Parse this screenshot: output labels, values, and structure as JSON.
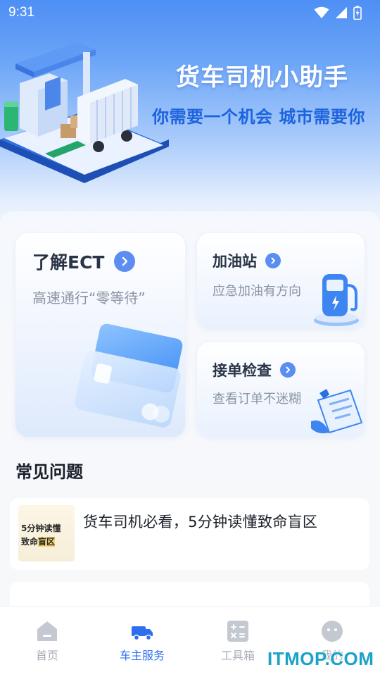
{
  "status_bar": {
    "time": "9:31"
  },
  "hero": {
    "title": "货车司机小助手",
    "subtitle": "你需要一个机会 城市需要你"
  },
  "cards": {
    "ect": {
      "title": "了解ECT",
      "desc": "高速通行“零等待”"
    },
    "gas": {
      "title": "加油站",
      "desc": "应急加油有方向"
    },
    "order": {
      "title": "接单检查",
      "desc": "查看订单不迷糊"
    }
  },
  "faq": {
    "section_title": "常见问题",
    "articles": [
      {
        "title": "货车司机必看，5分钟读懂致命盲区",
        "thumb_line1": "5分钟读懂",
        "thumb_line2_a": "致命",
        "thumb_line2_b": "盲区"
      }
    ]
  },
  "tabbar": {
    "tabs": [
      {
        "label": "首页",
        "icon": "home-icon"
      },
      {
        "label": "车主服务",
        "icon": "truck-icon"
      },
      {
        "label": "工具箱",
        "icon": "calculator-icon"
      },
      {
        "label": "我的",
        "icon": "profile-icon"
      }
    ],
    "active_index": 1,
    "active_color": "#2e6ff0",
    "inactive_color": "#a8adb8"
  },
  "watermark": "ITMOP.COM"
}
